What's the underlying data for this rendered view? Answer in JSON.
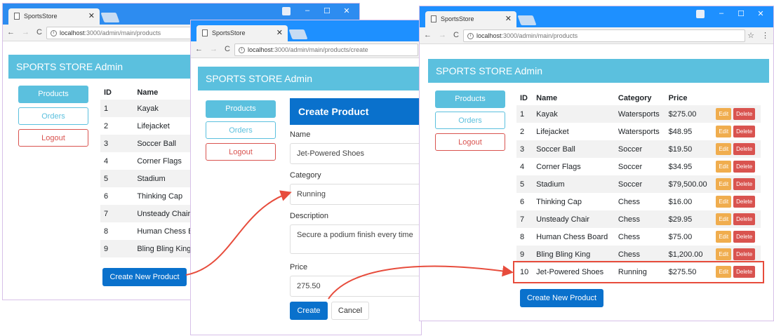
{
  "colors": {
    "titlebar": "#1e90ff",
    "header": "#5bc0de",
    "primary": "#0a71cc",
    "warning": "#f0ad4e",
    "danger": "#d9534f",
    "arrow": "#e74c3c"
  },
  "browser": {
    "tab_title": "SportsStore",
    "host": "localhost",
    "w1_path": ":3000/admin/main/products",
    "w2_path": ":3000/admin/main/products/create",
    "w3_path": ":3000/admin/main/products"
  },
  "admin": {
    "title": "SPORTS STORE Admin",
    "nav_products": "Products",
    "nav_orders": "Orders",
    "nav_logout": "Logout"
  },
  "table": {
    "headers": [
      "ID",
      "Name",
      "Category",
      "Price"
    ],
    "rows": [
      {
        "id": "1",
        "name": "Kayak",
        "category": "Watersports",
        "price": "$275.00"
      },
      {
        "id": "2",
        "name": "Lifejacket",
        "category": "Watersports",
        "price": "$48.95"
      },
      {
        "id": "3",
        "name": "Soccer Ball",
        "category": "Soccer",
        "price": "$19.50"
      },
      {
        "id": "4",
        "name": "Corner Flags",
        "category": "Soccer",
        "price": "$34.95"
      },
      {
        "id": "5",
        "name": "Stadium",
        "category": "Soccer",
        "price": "$79,500.00"
      },
      {
        "id": "6",
        "name": "Thinking Cap",
        "category": "Chess",
        "price": "$16.00"
      },
      {
        "id": "7",
        "name": "Unsteady Chair",
        "category": "Chess",
        "price": "$29.95"
      },
      {
        "id": "8",
        "name": "Human Chess Board",
        "category": "Chess",
        "price": "$75.00"
      },
      {
        "id": "9",
        "name": "Bling Bling King",
        "category": "Chess",
        "price": "$1,200.00"
      },
      {
        "id": "10",
        "name": "Jet-Powered Shoes",
        "category": "Running",
        "price": "$275.50"
      }
    ],
    "edit_label": "Edit",
    "delete_label": "Delete",
    "create_new_label": "Create New Product"
  },
  "form": {
    "heading": "Create Product",
    "name_label": "Name",
    "name_value": "Jet-Powered Shoes",
    "category_label": "Category",
    "category_value": "Running",
    "description_label": "Description",
    "description_value": "Secure a podium finish every time",
    "price_label": "Price",
    "price_value": "275.50",
    "create_label": "Create",
    "cancel_label": "Cancel"
  }
}
